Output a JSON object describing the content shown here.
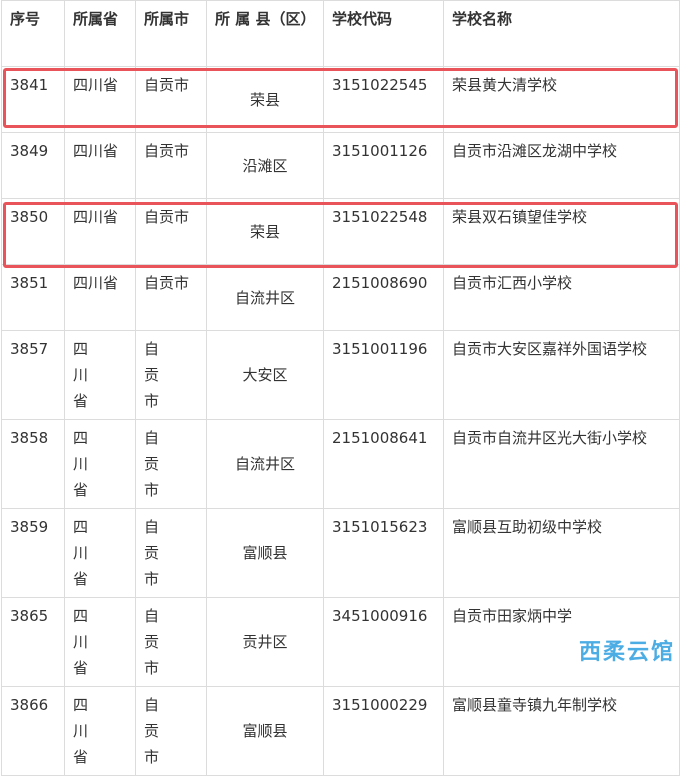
{
  "headers": [
    "序号",
    "所属省",
    "所属市",
    "所 属 县（区）",
    "学校代码",
    "学校名称"
  ],
  "rows": [
    {
      "no": "3841",
      "province": "四川省",
      "city": "自贡市",
      "county": "荣县",
      "code": "3151022545",
      "name": "荣县黄大清学校"
    },
    {
      "no": "3849",
      "province": "四川省",
      "city": "自贡市",
      "county": "沿滩区",
      "code": "3151001126",
      "name": "自贡市沿滩区龙湖中学校"
    },
    {
      "no": "3850",
      "province": "四川省",
      "city": "自贡市",
      "county": "荣县",
      "code": "3151022548",
      "name": "荣县双石镇望佳学校"
    },
    {
      "no": "3851",
      "province": "四川省",
      "city": "自贡市",
      "county": "自流井区",
      "code": "2151008690",
      "name": "自贡市汇西小学校"
    },
    {
      "no": "3857",
      "province": "四川省",
      "city": "自贡市",
      "county": "大安区",
      "code": "3151001196",
      "name": "自贡市大安区嘉祥外国语学校"
    },
    {
      "no": "3858",
      "province": "四川省",
      "city": "自贡市",
      "county": "自流井区",
      "code": "2151008641",
      "name": "自贡市自流井区光大街小学校"
    },
    {
      "no": "3859",
      "province": "四川省",
      "city": "自贡市",
      "county": "富顺县",
      "code": "3151015623",
      "name": "富顺县互助初级中学校"
    },
    {
      "no": "3865",
      "province": "四川省",
      "city": "自贡市",
      "county": "贡井区",
      "code": "3451000916",
      "name": "自贡市田家炳中学"
    },
    {
      "no": "3866",
      "province": "四川省",
      "city": "自贡市",
      "county": "富顺县",
      "code": "3151000229",
      "name": "富顺县童寺镇九年制学校"
    }
  ],
  "watermark": "西柔云馆"
}
